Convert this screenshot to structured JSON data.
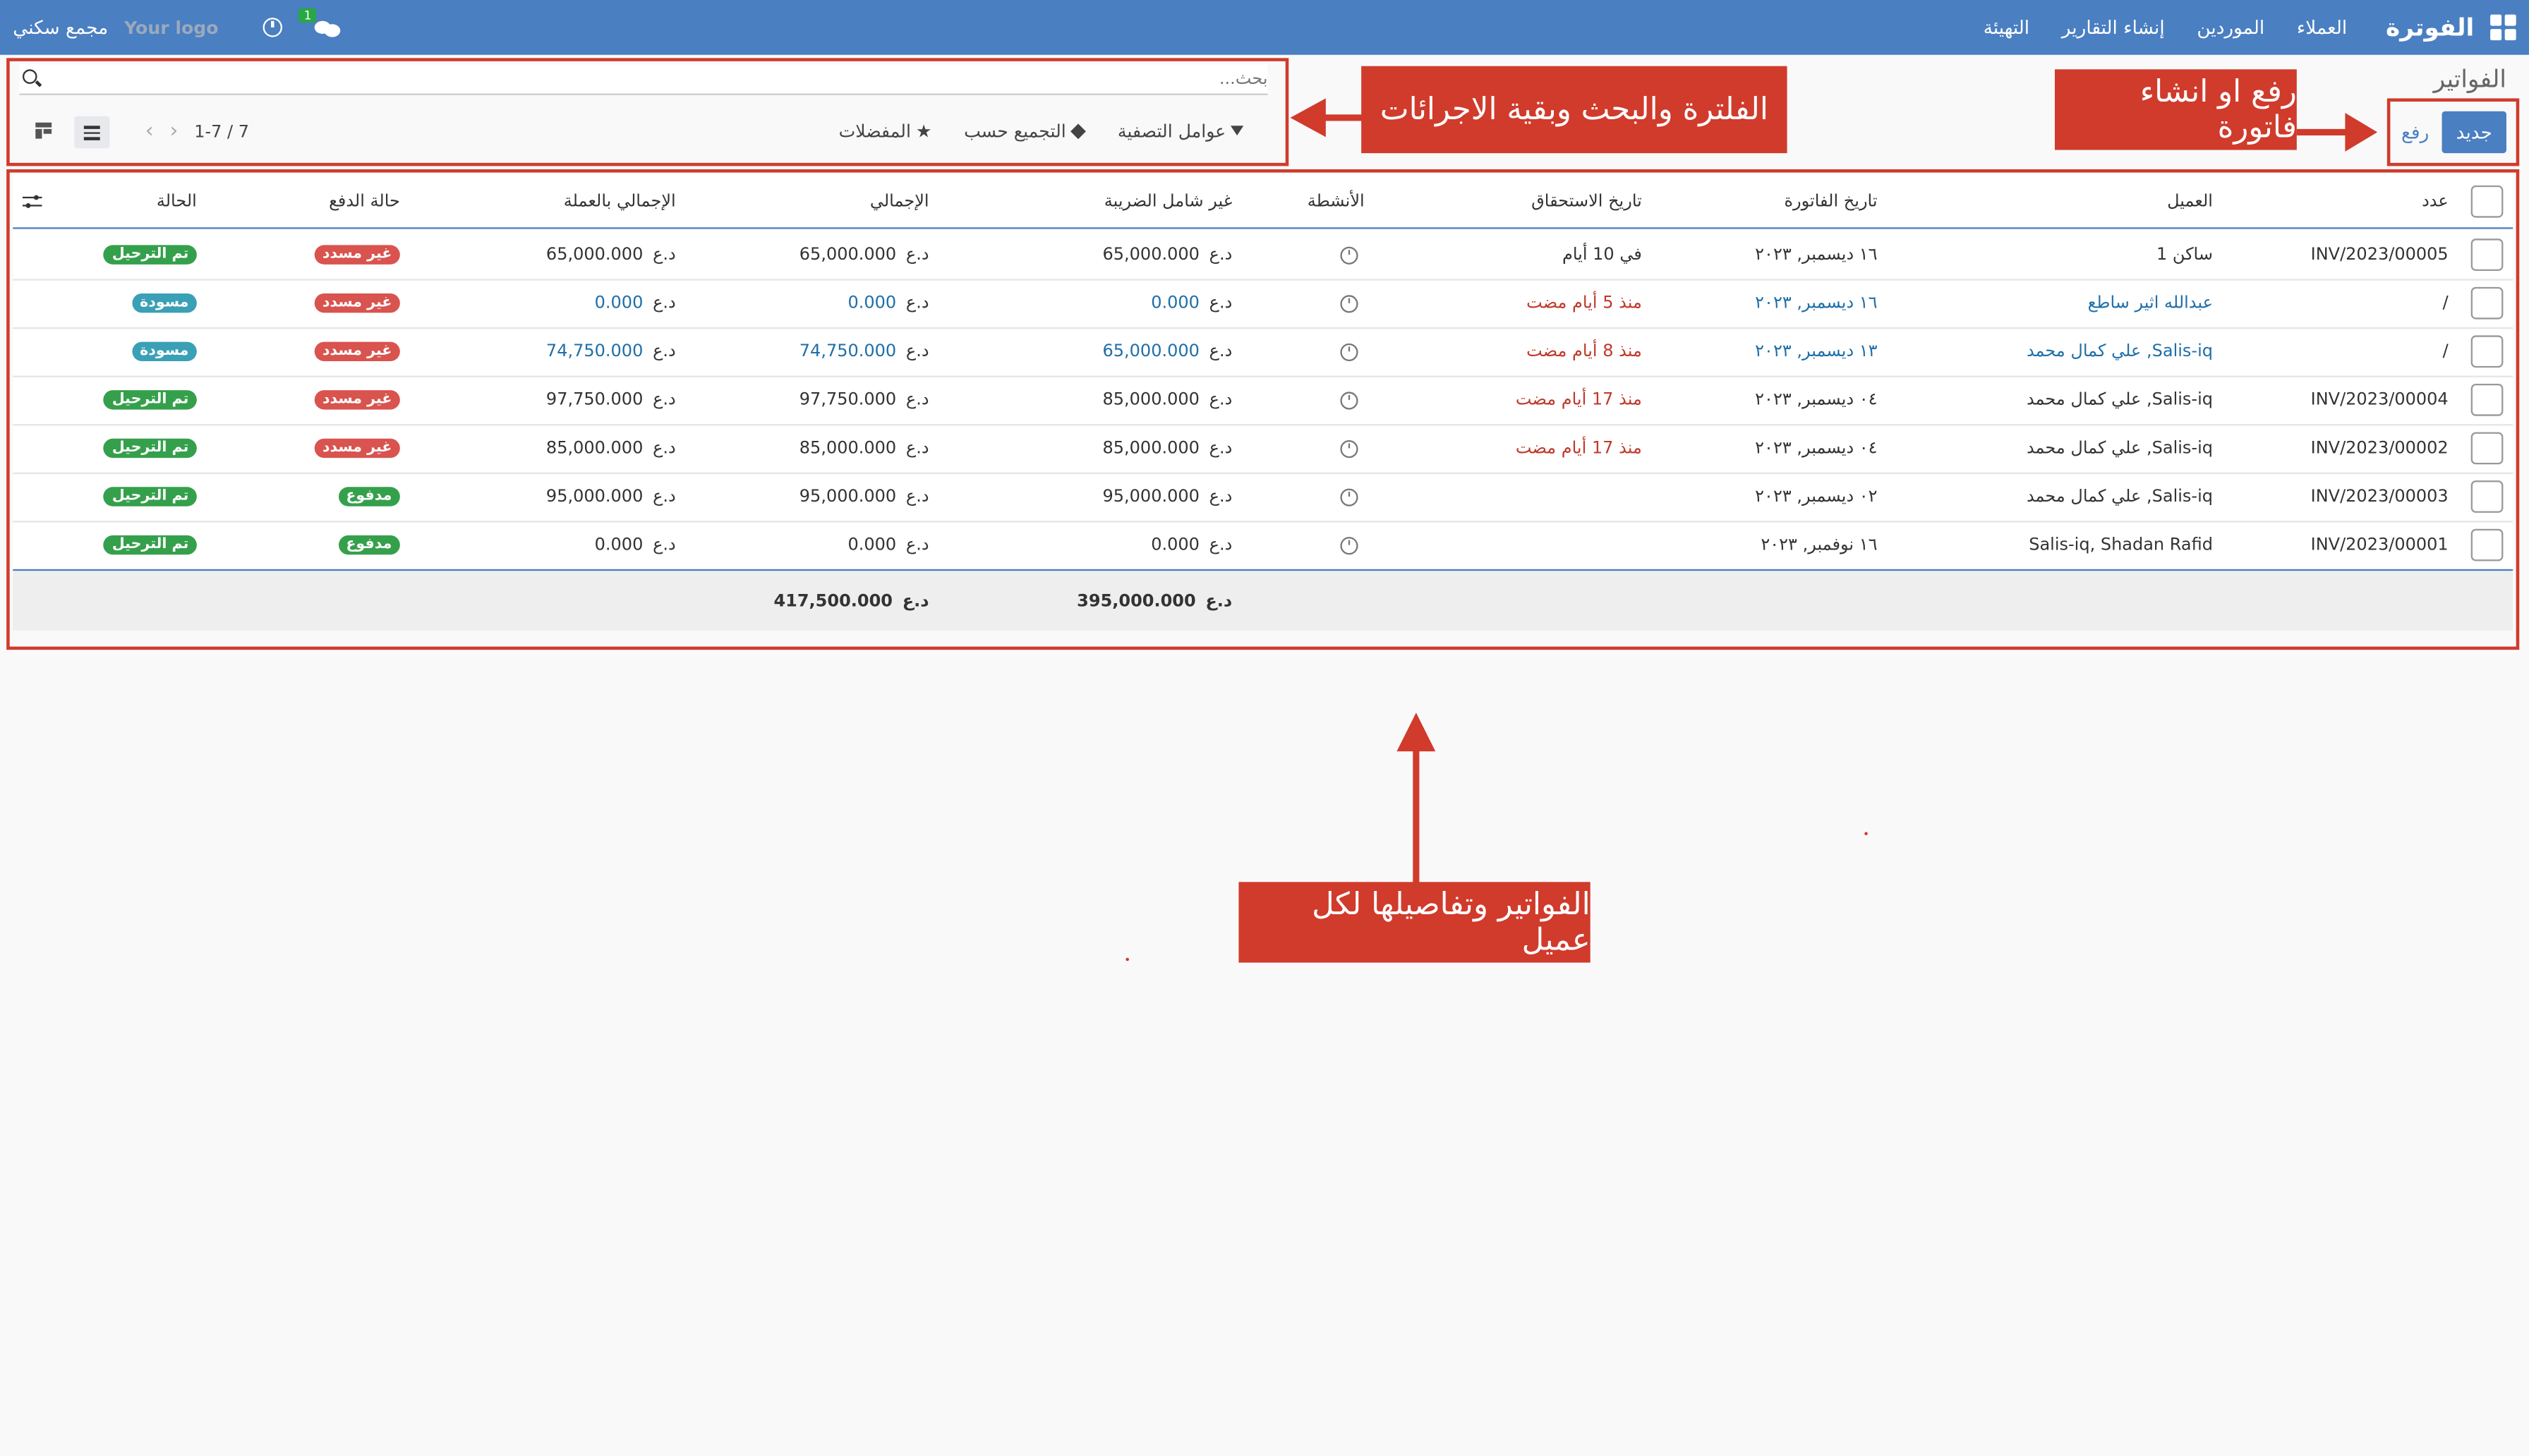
{
  "colors": {
    "navbar": "#4a7fc1",
    "accent": "#4a7fc1",
    "annotation": "#d03b2c",
    "badge_red": "#d9534f",
    "badge_green": "#35a04b",
    "badge_teal": "#3aa0b6"
  },
  "navbar": {
    "brand": "الفوترة",
    "menu": [
      "العملاء",
      "الموردين",
      "إنشاء التقارير",
      "التهيئة"
    ],
    "chat_count": "1",
    "logo_text": "Your logo",
    "company": "مجمع سكني"
  },
  "control": {
    "breadcrumb": "الفواتير",
    "new_label": "جديد",
    "upload_label": "رفع",
    "search_placeholder": "بحث...",
    "filters_label": "عوامل التصفية",
    "groupby_label": "التجميع حسب",
    "favorites_label": "المفضلات",
    "pager": "1-7 / 7"
  },
  "table": {
    "headers": {
      "number": "عدد",
      "partner": "العميل",
      "invoice_date": "تاريخ الفاتورة",
      "due_date": "تاريخ الاستحقاق",
      "activities": "الأنشطة",
      "untaxed": "غير شامل الضريبة",
      "total": "الإجمالي",
      "total_currency": "الإجمالي بالعملة",
      "payment_state": "حالة الدفع",
      "state": "الحالة"
    },
    "currency": "د.ع",
    "rows": [
      {
        "number": "INV/2023/00005",
        "partner": "ساكن 1",
        "partner_link": false,
        "invoice_date": "١٦ ديسمبر, ٢٠٢٣",
        "invoice_date_link": false,
        "due": "في 10 أيام",
        "due_red": false,
        "untaxed": "65,000.000",
        "untaxed_link": false,
        "total": "65,000.000",
        "total_link": false,
        "total_cur": "65,000.000",
        "total_cur_link": false,
        "payment": "غير مسدد",
        "payment_color": "red",
        "state": "تم الترحيل",
        "state_color": "green"
      },
      {
        "number": "/",
        "partner": "عبدالله اثير ساطع",
        "partner_link": true,
        "invoice_date": "١٦ ديسمبر, ٢٠٢٣",
        "invoice_date_link": true,
        "due": "منذ 5 أيام مضت",
        "due_red": true,
        "untaxed": "0.000",
        "untaxed_link": true,
        "total": "0.000",
        "total_link": true,
        "total_cur": "0.000",
        "total_cur_link": true,
        "payment": "غير مسدد",
        "payment_color": "red",
        "state": "مسودة",
        "state_color": "teal"
      },
      {
        "number": "/",
        "partner": "Salis-iq, علي كمال محمد",
        "partner_link": true,
        "invoice_date": "١٣ ديسمبر, ٢٠٢٣",
        "invoice_date_link": true,
        "due": "منذ 8 أيام مضت",
        "due_red": true,
        "untaxed": "65,000.000",
        "untaxed_link": true,
        "total": "74,750.000",
        "total_link": true,
        "total_cur": "74,750.000",
        "total_cur_link": true,
        "payment": "غير مسدد",
        "payment_color": "red",
        "state": "مسودة",
        "state_color": "teal"
      },
      {
        "number": "INV/2023/00004",
        "partner": "Salis-iq, علي كمال محمد",
        "partner_link": false,
        "invoice_date": "٠٤ ديسمبر, ٢٠٢٣",
        "invoice_date_link": false,
        "due": "منذ 17 أيام مضت",
        "due_red": true,
        "untaxed": "85,000.000",
        "untaxed_link": false,
        "total": "97,750.000",
        "total_link": false,
        "total_cur": "97,750.000",
        "total_cur_link": false,
        "payment": "غير مسدد",
        "payment_color": "red",
        "state": "تم الترحيل",
        "state_color": "green"
      },
      {
        "number": "INV/2023/00002",
        "partner": "Salis-iq, علي كمال محمد",
        "partner_link": false,
        "invoice_date": "٠٤ ديسمبر, ٢٠٢٣",
        "invoice_date_link": false,
        "due": "منذ 17 أيام مضت",
        "due_red": true,
        "untaxed": "85,000.000",
        "untaxed_link": false,
        "total": "85,000.000",
        "total_link": false,
        "total_cur": "85,000.000",
        "total_cur_link": false,
        "payment": "غير مسدد",
        "payment_color": "red",
        "state": "تم الترحيل",
        "state_color": "green"
      },
      {
        "number": "INV/2023/00003",
        "partner": "Salis-iq, علي كمال محمد",
        "partner_link": false,
        "invoice_date": "٠٢ ديسمبر, ٢٠٢٣",
        "invoice_date_link": false,
        "due": "",
        "due_red": false,
        "untaxed": "95,000.000",
        "untaxed_link": false,
        "total": "95,000.000",
        "total_link": false,
        "total_cur": "95,000.000",
        "total_cur_link": false,
        "payment": "مدفوع",
        "payment_color": "green",
        "state": "تم الترحيل",
        "state_color": "green"
      },
      {
        "number": "INV/2023/00001",
        "partner": "Salis-iq, Shadan Rafid",
        "partner_link": false,
        "invoice_date": "١٦ نوفمبر, ٢٠٢٣",
        "invoice_date_link": false,
        "due": "",
        "due_red": false,
        "untaxed": "0.000",
        "untaxed_link": false,
        "total": "0.000",
        "total_link": false,
        "total_cur": "0.000",
        "total_cur_link": false,
        "payment": "مدفوع",
        "payment_color": "green",
        "state": "تم الترحيل",
        "state_color": "green"
      }
    ],
    "footer": {
      "untaxed_sum": "395,000.000",
      "total_sum": "417,500.000"
    }
  },
  "annotations": {
    "create_upload": "رفع او انشاء فاتورة",
    "filters": "الفلترة والبحث وبقية الاجرائات",
    "invoices": "الفواتير وتفاصيلها لكل عميل"
  }
}
